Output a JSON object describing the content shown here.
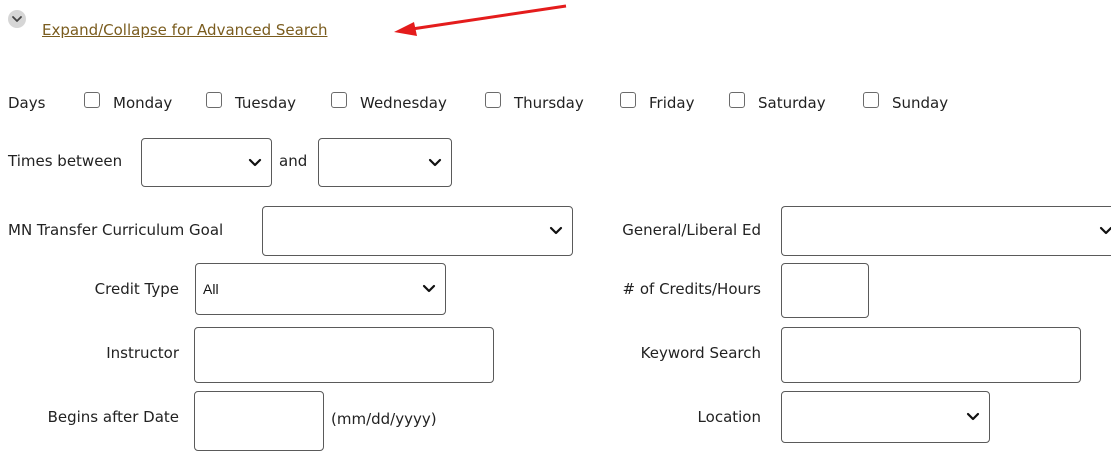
{
  "advanced_search": {
    "toggle_label": "Expand/Collapse for Advanced Search"
  },
  "days": {
    "label": "Days",
    "options": [
      "Monday",
      "Tuesday",
      "Wednesday",
      "Thursday",
      "Friday",
      "Saturday",
      "Sunday"
    ]
  },
  "times": {
    "label": "Times between",
    "and_label": "and",
    "start_value": "",
    "end_value": ""
  },
  "mn_transfer": {
    "label": "MN Transfer Curriculum Goal",
    "value": ""
  },
  "general_ed": {
    "label": "General/Liberal Ed",
    "value": ""
  },
  "credit_type": {
    "label": "Credit Type",
    "value": "All"
  },
  "credits_hours": {
    "label": "# of Credits/Hours",
    "value": ""
  },
  "instructor": {
    "label": "Instructor",
    "value": ""
  },
  "keyword": {
    "label": "Keyword Search",
    "value": ""
  },
  "begins_after": {
    "label": "Begins after Date",
    "value": "",
    "hint": "(mm/dd/yyyy)"
  },
  "location": {
    "label": "Location",
    "value": ""
  },
  "colors": {
    "link": "#7a5c1e",
    "arrow": "#e41c1c",
    "border": "#5a5a5a"
  },
  "icons": {
    "toggle": "chevron-down-circle-icon",
    "select": "chevron-down-icon",
    "annotation": "red-arrow-icon"
  }
}
